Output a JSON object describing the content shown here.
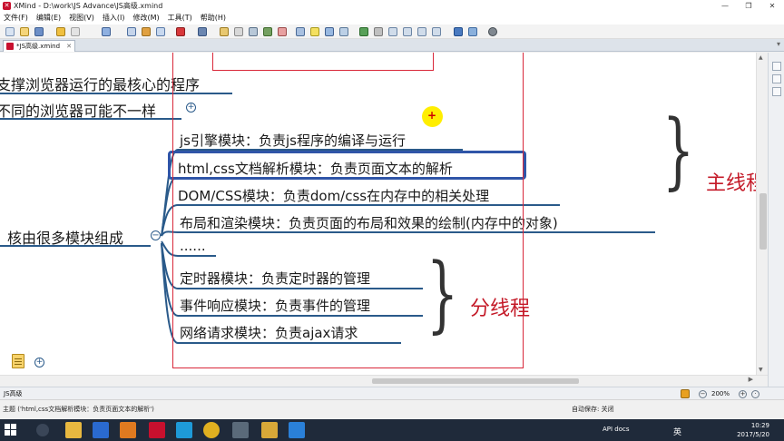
{
  "window": {
    "title": "XMind - D:\\work\\JS Advance\\JS高级.xmind",
    "minimize": "—",
    "maximize": "❐",
    "close": "✕"
  },
  "menu": [
    "文件(F)",
    "编辑(E)",
    "视图(V)",
    "插入(I)",
    "修改(M)",
    "工具(T)",
    "帮助(H)"
  ],
  "tab": {
    "label": "*JS高级.xmind",
    "close": "✕"
  },
  "mindmap": {
    "left_top_1": "支撑浏览器运行的最核心的程序",
    "left_top_2": "不同的浏览器可能不一样",
    "left_main": "核由很多模块组成",
    "collapse": "⊖",
    "expand": "+",
    "items": [
      "js引擎模块：负责js程序的编译与运行",
      "html,css文档解析模块：负责页面文本的解析",
      "DOM/CSS模块：负责dom/css在内存中的相关处理",
      "布局和渲染模块：负责页面的布局和效果的绘制(内存中的对象)",
      "......",
      "定时器模块：负责定时器的管理",
      "事件响应模块：负责事件的管理",
      "网络请求模块：负责ajax请求"
    ],
    "main_thread_label": "主线程",
    "sub_thread_label": "分线程",
    "cursor_plus": "+"
  },
  "sheet": {
    "tab": "JS高级",
    "zoom": "200%",
    "zoom_in": "+",
    "zoom_out": "−"
  },
  "status": {
    "topic": "主题 ('html,css文档解析模块：负责页面文本的解析')",
    "autosave": "自动保存: 关闭"
  },
  "taskbar": {
    "ime": "英",
    "tray_text": "API docs",
    "time": "10:29",
    "date": "2017/5/20"
  },
  "colors": {
    "accent_red": "#d9283a",
    "label_red": "#c41a28",
    "node_line": "#2a5a8a",
    "selected_border": "#2f55a8",
    "cursor_yellow": "#ffee00"
  }
}
